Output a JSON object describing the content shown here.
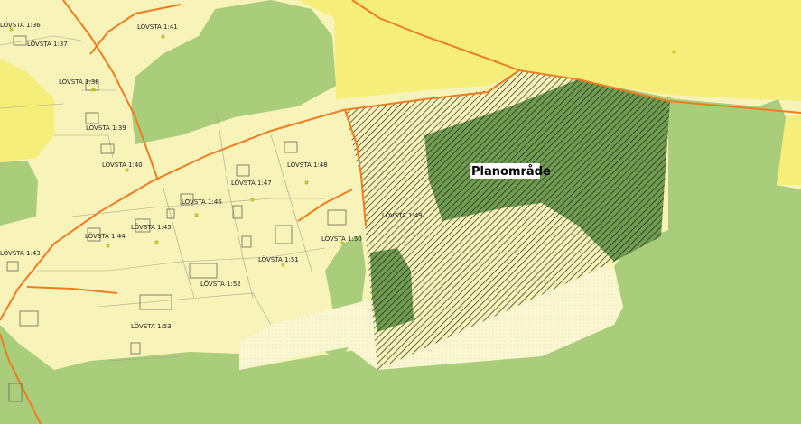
{
  "map": {
    "plan_label": "Planområde",
    "plots": [
      "LÖVSTA 1:36",
      "LÖVSTA 1:37",
      "LÖVSTA 1:41",
      "LÖVSTA 1:38",
      "LÖVSTA 1:39",
      "LÖVSTA 1:40",
      "LÖVSTA 1:48",
      "LÖVSTA 1:47",
      "LÖVSTA 1:46",
      "LÖVSTA 1:49",
      "LÖVSTA 1:45",
      "LÖVSTA 1:44",
      "LÖVSTA 1:50",
      "LÖVSTA 1:43",
      "LÖVSTA 1:51",
      "LÖVSTA 1:52",
      "LÖVSTA 1:53"
    ],
    "colors": {
      "residential": "#f7f3b9",
      "field_yellow": "#f6ee7a",
      "forest_green": "#a9cd7b",
      "dark_forest": "#6f9c4f",
      "road": "#ee7d22",
      "hatch": "#000000"
    }
  }
}
